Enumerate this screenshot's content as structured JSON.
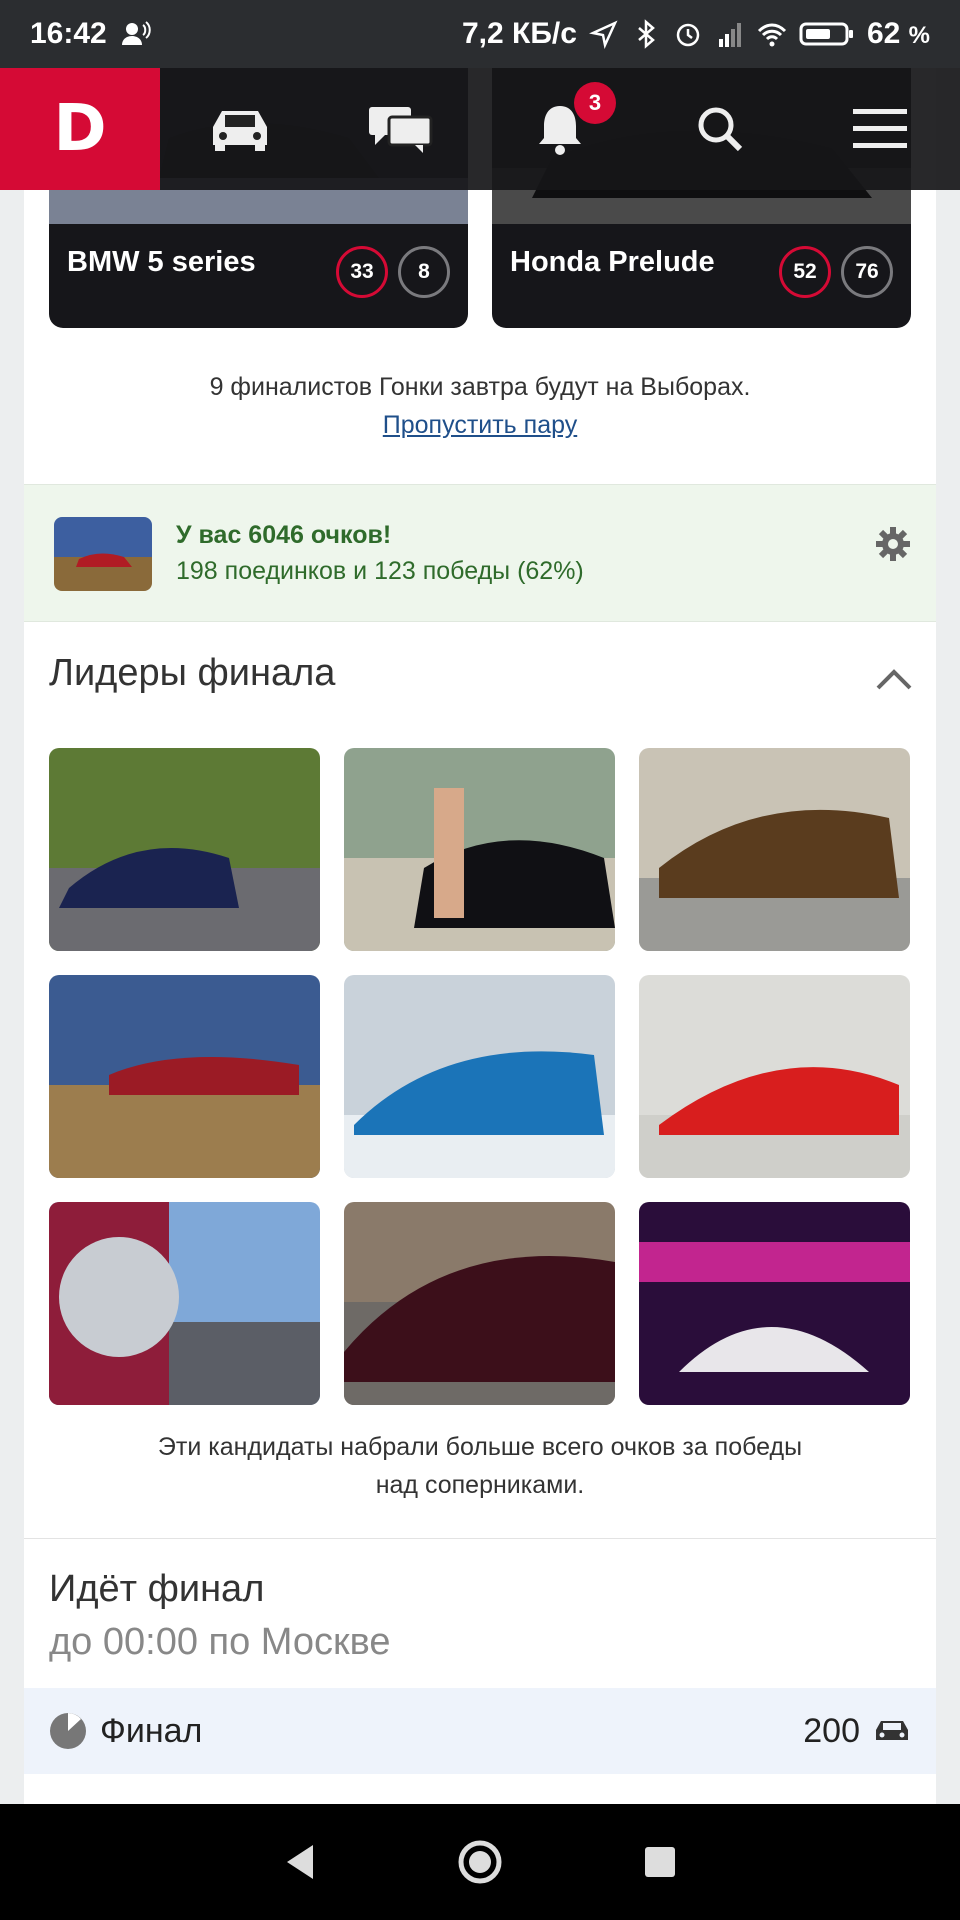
{
  "status_bar": {
    "time": "16:42",
    "net_speed": "7,2 КБ/с",
    "battery": "62",
    "battery_unit": "%"
  },
  "nav": {
    "logo": "D",
    "notifications_count": "3"
  },
  "cars": [
    {
      "name": "BMW 5 series",
      "score_a": "33",
      "score_b": "8"
    },
    {
      "name": "Honda Prelude",
      "score_a": "52",
      "score_b": "76"
    }
  ],
  "finalists": {
    "note": "9 финалистов Гонки завтра будут на Выборах.",
    "skip_link": "Пропустить пару"
  },
  "points": {
    "title": "У вас 6046 очков!",
    "subtitle": "198 поединков и 123 победы (62%)"
  },
  "leaders": {
    "title": "Лидеры финала",
    "note_line1": "Эти кандидаты набрали больше всего очков за победы",
    "note_line2": "над соперниками."
  },
  "final": {
    "title": "Идёт финал",
    "subtitle": "до 00:00 по Москве",
    "row_label": "Финал",
    "row_count": "200"
  }
}
